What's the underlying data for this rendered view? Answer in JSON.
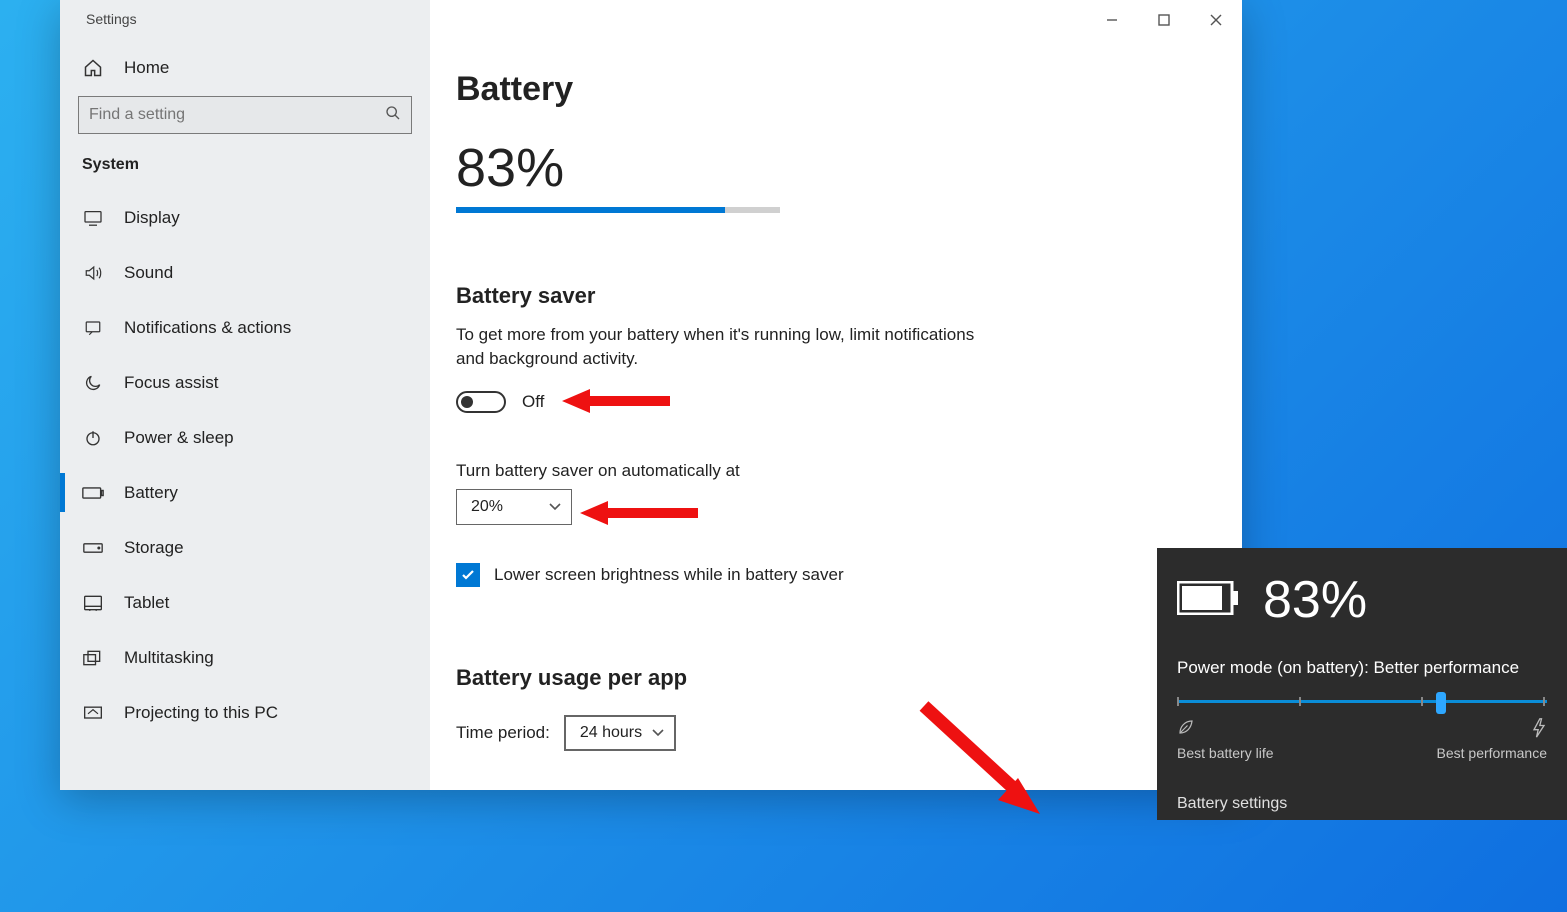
{
  "window": {
    "title": "Settings"
  },
  "sidebar": {
    "home": "Home",
    "search_placeholder": "Find a setting",
    "category": "System",
    "items": [
      {
        "label": "Display"
      },
      {
        "label": "Sound"
      },
      {
        "label": "Notifications & actions"
      },
      {
        "label": "Focus assist"
      },
      {
        "label": "Power & sleep"
      },
      {
        "label": "Battery"
      },
      {
        "label": "Storage"
      },
      {
        "label": "Tablet"
      },
      {
        "label": "Multitasking"
      },
      {
        "label": "Projecting to this PC"
      }
    ]
  },
  "page": {
    "title": "Battery",
    "percent_text": "83%",
    "percent_value": 83,
    "saver": {
      "heading": "Battery saver",
      "desc": "To get more from your battery when it's running low, limit notifications and background activity.",
      "toggle_state": "Off",
      "auto_label": "Turn battery saver on automatically at",
      "auto_value": "20%",
      "brightness_checkbox": "Lower screen brightness while in battery saver"
    },
    "usage": {
      "heading": "Battery usage per app",
      "time_label": "Time period:",
      "time_value": "24 hours"
    }
  },
  "tray": {
    "percent": "83%",
    "mode_label": "Power mode (on battery): ",
    "mode_value": "Better performance",
    "low_label": "Best battery life",
    "high_label": "Best performance",
    "link": "Battery settings"
  }
}
